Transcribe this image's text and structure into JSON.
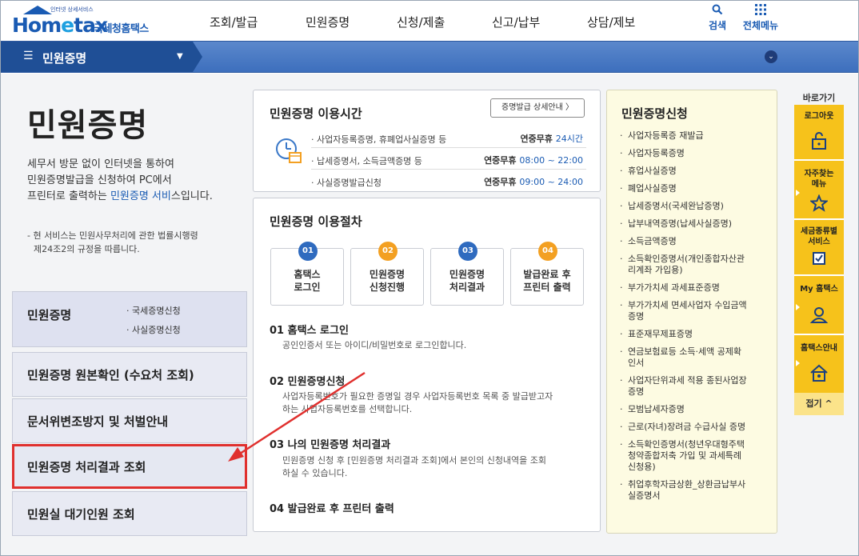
{
  "header": {
    "logo_tagline": "인터넷 상세서비스",
    "logo_word_1": "Hom",
    "logo_word_2": "e",
    "logo_word_3": "tax",
    "logo_korean": "국세청홈택스",
    "menu": [
      "조회/발급",
      "민원증명",
      "신청/제출",
      "신고/납부",
      "상담/제보"
    ],
    "search_label": "검색",
    "allmenu_label": "전체메뉴"
  },
  "navbar": {
    "label": "민원증명"
  },
  "left": {
    "title": "민원증명",
    "desc_line1": "세무서 방문 없이 인터넷을 통하여",
    "desc_line2": "민원증명발급을 신청하여 PC에서",
    "desc_line3_pre": "프린터로 출력하는 ",
    "desc_line3_link": "민원증명 서비",
    "desc_line3_post": "스입니다.",
    "note_line1": "- 현 서비스는 민원사무처리에 관한 법률시행령",
    "note_line2": "제24조2의 규정을 따릅니다.",
    "box1_title": "민원증명",
    "box1_sub1": "· 국세증명신청",
    "box1_sub2": "· 사실증명신청",
    "box2_title": "민원증명 원본확인 (수요처 조회)",
    "box3_title": "문서위변조방지 및 처벌안내",
    "box4_title": "민원증명 처리결과 조회",
    "box5_title": "민원실 대기인원 조회"
  },
  "hours": {
    "title": "민원증명 이용시간",
    "detail_button": "증명발급 상세안내 〉",
    "rows": [
      {
        "label": "· 사업자등록증명, 휴폐업사실증명 등",
        "pre": "연중무휴 ",
        "value": "24시간"
      },
      {
        "label": "· 납세증명서, 소득금액증명 등",
        "pre": "연중무휴 ",
        "value": "08:00 ~ 22:00"
      },
      {
        "label": "· 사실증명발급신청",
        "pre": "연중무휴 ",
        "value": "09:00 ~ 24:00"
      }
    ]
  },
  "procedure": {
    "title": "민원증명 이용절차",
    "steps": [
      {
        "num": "01",
        "line1": "홈택스",
        "line2": "로그인",
        "color": "#2f6bbf"
      },
      {
        "num": "02",
        "line1": "민원증명",
        "line2": "신청진행",
        "color": "#f3a022"
      },
      {
        "num": "03",
        "line1": "민원증명",
        "line2": "처리결과",
        "color": "#2f6bbf"
      },
      {
        "num": "04",
        "line1": "발급완료 후",
        "line2": "프린터 출력",
        "color": "#f3a022"
      }
    ],
    "items": [
      {
        "head": "01 홈택스 로그인",
        "d1": "공인인증서 또는 아이디/비밀번호로 로그인합니다.",
        "d2": ""
      },
      {
        "head": "02 민원증명신청",
        "d1": "사업자등록번호가 필요한 증명일 경우 사업자등록번호 목록 중 발급받고자",
        "d2": "하는 사업자등록번호를 선택합니다."
      },
      {
        "head": "03 나의 민원증명 처리결과",
        "d1": "민원증명 신청 후 [민원증명 처리결과 조회]에서 본인의 신청내역을 조회",
        "d2": "하실 수 있습니다."
      },
      {
        "head": "04 발급완료 후 프린터 출력",
        "d1": "",
        "d2": ""
      }
    ]
  },
  "apply": {
    "title": "민원증명신청",
    "items": [
      [
        "사업자등록증 재발급"
      ],
      [
        "사업자등록증명"
      ],
      [
        "휴업사실증명"
      ],
      [
        "폐업사실증명"
      ],
      [
        "납세증명서(국세완납증명)"
      ],
      [
        "납부내역증명(납세사실증명)"
      ],
      [
        "소득금액증명"
      ],
      [
        "소득확인증명서(개인종합자산관",
        "리계좌 가입용)"
      ],
      [
        "부가가치세 과세표준증명"
      ],
      [
        "부가가치세 면세사업자 수입금액",
        "증명"
      ],
      [
        "표준재무제표증명"
      ],
      [
        "연금보험료등 소득·세액 공제확",
        "인서"
      ],
      [
        "사업자단위과세 적용 종된사업장",
        "증명"
      ],
      [
        "모범납세자증명"
      ],
      [
        "근로(자녀)장려금 수급사실 증명"
      ],
      [
        "소득확인증명서(청년우대형주택",
        "청약종합저축 가입 및 과세특례",
        "신청용)"
      ],
      [
        "취업후학자금상환_상환금납부사",
        "실증명서"
      ]
    ]
  },
  "quick": {
    "title": "바로가기",
    "items": [
      {
        "label1": "로그아웃",
        "label2": "",
        "icon": "unlock-icon"
      },
      {
        "label1": "자주찾는",
        "label2": "메뉴",
        "icon": "star-icon"
      },
      {
        "label1": "세금종류별",
        "label2": "서비스",
        "icon": "checkbox-icon"
      },
      {
        "label1": "My 홈택스",
        "label2": "",
        "icon": "user-icon"
      },
      {
        "label1": "홈택스안내",
        "label2": "",
        "icon": "house-icon"
      }
    ],
    "close": "접기 ^"
  }
}
